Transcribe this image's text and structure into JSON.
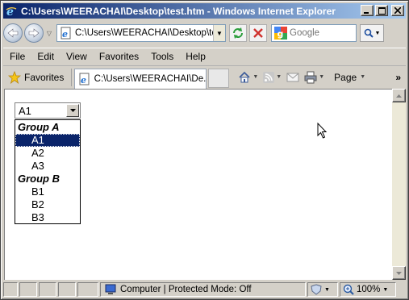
{
  "window": {
    "title": "C:\\Users\\WEERACHAI\\Desktop\\test.htm - Windows Internet Explorer"
  },
  "address_bar": {
    "url": "C:\\Users\\WEERACHAI\\Desktop\\test.htm"
  },
  "search": {
    "placeholder": "Google"
  },
  "menu": {
    "items": [
      "File",
      "Edit",
      "View",
      "Favorites",
      "Tools",
      "Help"
    ]
  },
  "toolbar": {
    "favorites_label": "Favorites",
    "tab_title": "C:\\Users\\WEERACHAI\\De...",
    "page_label": "Page",
    "chevron": "»"
  },
  "select": {
    "value": "A1",
    "groups": [
      {
        "label": "Group A",
        "options": [
          "A1",
          "A2",
          "A3"
        ]
      },
      {
        "label": "Group B",
        "options": [
          "B1",
          "B2",
          "B3"
        ]
      }
    ],
    "highlighted": "A1"
  },
  "status": {
    "zone": "Computer | Protected Mode: Off",
    "zoom": "100%"
  },
  "colors": {
    "title_start": "#0a246a",
    "title_end": "#a6caf0",
    "highlight": "#0a246a"
  }
}
